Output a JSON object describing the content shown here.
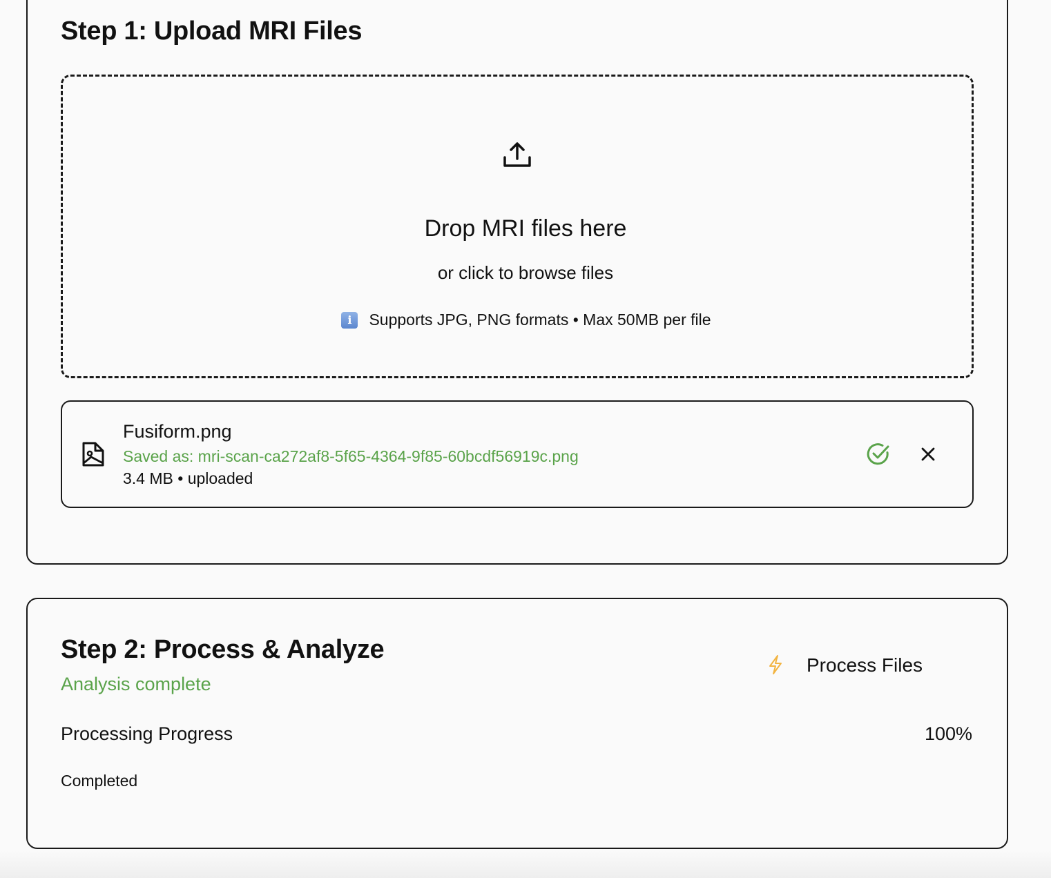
{
  "step1": {
    "title": "Step 1: Upload MRI Files",
    "dropzone": {
      "title": "Drop MRI files here",
      "subtitle": "or click to browse files",
      "info": "Supports JPG, PNG formats • Max 50MB per file",
      "icon": "upload-icon"
    },
    "file": {
      "name": "Fusiform.png",
      "saved_as": "Saved as: mri-scan-ca272af8-5f65-4364-9f85-60bcdf56919c.png",
      "meta": "3.4 MB • uploaded",
      "status_icon": "check-circle-icon",
      "remove_icon": "close-icon"
    }
  },
  "step2": {
    "title": "Step 2: Process & Analyze",
    "status": "Analysis complete",
    "process_button": "Process Files",
    "progress": {
      "label": "Processing Progress",
      "value_text": "100%",
      "value": 100,
      "state": "Completed"
    }
  },
  "colors": {
    "success": "#5aa34a",
    "border": "#1a1a1a",
    "bolt": "#f2b441",
    "info": "#6b95d8"
  }
}
